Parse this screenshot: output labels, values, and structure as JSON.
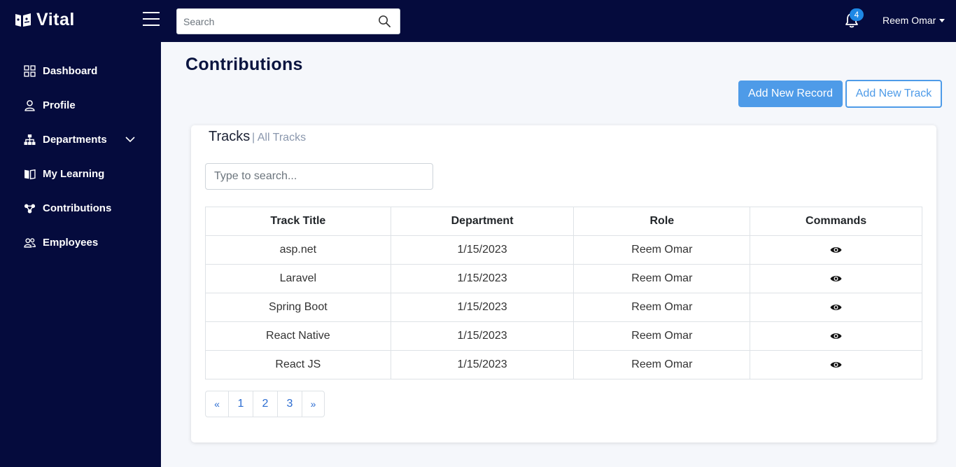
{
  "app": {
    "name": "Vital"
  },
  "search": {
    "placeholder": "Search"
  },
  "notifications": {
    "count": "4"
  },
  "user": {
    "name": "Reem Omar"
  },
  "sidebar": {
    "items": [
      {
        "label": "Dashboard",
        "icon": "grid-icon"
      },
      {
        "label": "Profile",
        "icon": "user-icon"
      },
      {
        "label": "Departments",
        "icon": "sitemap-icon",
        "expandable": true
      },
      {
        "label": "My Learning",
        "icon": "book-icon"
      },
      {
        "label": "Contributions",
        "icon": "contributions-icon"
      },
      {
        "label": "Employees",
        "icon": "users-icon"
      }
    ]
  },
  "page": {
    "title": "Contributions",
    "add_record_label": "Add New Record",
    "add_track_label": "Add New Track"
  },
  "card": {
    "title": "Tracks",
    "subtitle": "| All Tracks",
    "search_placeholder": "Type to search..."
  },
  "table": {
    "headers": [
      "Track Title",
      "Department",
      "Role",
      "Commands"
    ],
    "rows": [
      [
        "asp.net",
        "1/15/2023",
        "Reem Omar"
      ],
      [
        "Laravel",
        "1/15/2023",
        "Reem Omar"
      ],
      [
        "Spring Boot",
        "1/15/2023",
        "Reem Omar"
      ],
      [
        "React Native",
        "1/15/2023",
        "Reem Omar"
      ],
      [
        "React JS",
        "1/15/2023",
        "Reem Omar"
      ]
    ]
  },
  "pagination": {
    "prev": "«",
    "pages": [
      "1",
      "2",
      "3"
    ],
    "next": "»"
  },
  "colors": {
    "nav_bg": "#050b3d",
    "accent": "#4e9be8",
    "badge": "#1e88e5"
  }
}
